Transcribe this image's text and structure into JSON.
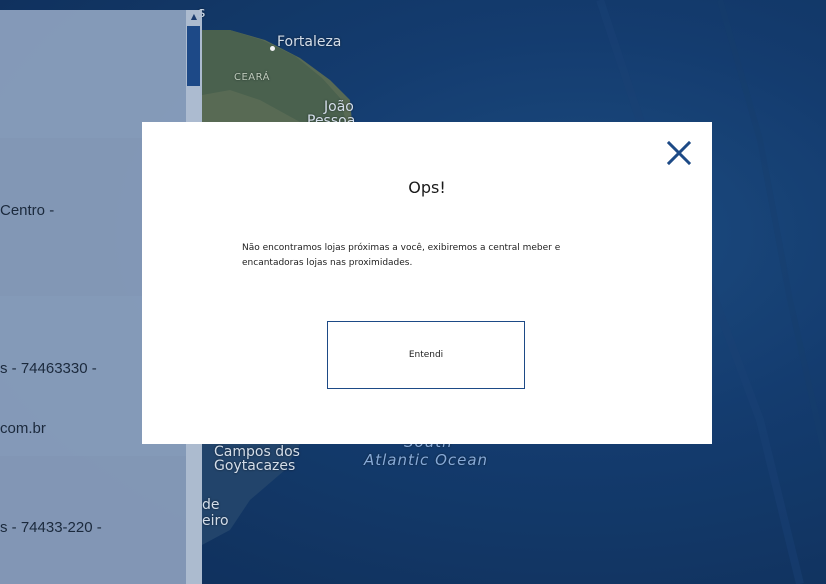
{
  "map": {
    "labels": {
      "fortaleza": "Fortaleza",
      "ceara": "CEARÁ",
      "joao_pessoa_1": "João",
      "joao_pessoa_2": "Pessoa",
      "campos_1": "Campos dos",
      "campos_2": "Goytacazes",
      "rio_1": "de",
      "rio_2": "eiro",
      "ocean_1": "South",
      "ocean_2": "Atlantic Ocean",
      "top_s": "s"
    }
  },
  "store_list": {
    "items": [
      {
        "text": "Centro -"
      },
      {
        "text": "s - 74463330 -"
      },
      {
        "text": "com.br"
      },
      {
        "text": "s - 74433-220 -"
      }
    ]
  },
  "modal": {
    "title": "Ops!",
    "message": "Não encontramos lojas próximas a você, exibiremos a central meber e encantadoras lojas nas proximidades.",
    "button_label": "Entendi",
    "close_icon": "close-icon"
  }
}
